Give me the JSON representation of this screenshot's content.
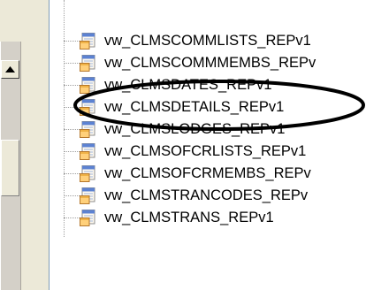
{
  "tree": {
    "items": [
      {
        "label": "vw_CLMSCOMMLISTS_REPv1",
        "icon": "view-icon"
      },
      {
        "label": "vw_CLMSCOMMMEMBS_REPv",
        "icon": "view-icon"
      },
      {
        "label": "vw_CLMSDATES_REPv1",
        "icon": "view-icon"
      },
      {
        "label": "vw_CLMSDETAILS_REPv1",
        "icon": "view-icon"
      },
      {
        "label": "vw_CLMSLODGES_REPv1",
        "icon": "view-icon"
      },
      {
        "label": "vw_CLMSOFCRLISTS_REPv1",
        "icon": "view-icon"
      },
      {
        "label": "vw_CLMSOFCRMEMBS_REPv",
        "icon": "view-icon"
      },
      {
        "label": "vw_CLMSTRANCODES_REPv",
        "icon": "view-icon"
      },
      {
        "label": "vw_CLMSTRANS_REPv1",
        "icon": "view-icon"
      }
    ]
  },
  "colors": {
    "ellipse": "#000000",
    "tree_background": "#ffffff",
    "panel_background": "#ece9d8"
  }
}
